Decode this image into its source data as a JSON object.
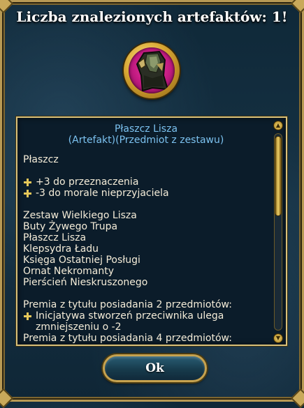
{
  "dialog": {
    "title": "Liczba znalezionych artefaktów: 1!",
    "ok_label": "Ok"
  },
  "item": {
    "icon": "cloak-artifact-icon",
    "name": "Płaszcz Lisza",
    "type": "(Artefakt)(Przedmiot z zestawu)",
    "slot": "Płaszcz",
    "bonuses": [
      "+3 do przeznaczenia",
      "-3 do morale nieprzyjaciela"
    ],
    "set_name": "Zestaw Wielkiego Lisza",
    "set_items": [
      "Buty Żywego Trupa",
      "Płaszcz Lisza",
      "Klepsydra Ładu",
      "Księga Ostatniej Posługi",
      "Ornat Nekromanty",
      "Pierścień Nieskruszonego"
    ],
    "set_bonus_2_header": "Premia z tytułu posiadania 2 przedmiotów:",
    "set_bonus_2_text": "Inicjatywa stworzeń przeciwnika ulega zmniejszeniu o -2",
    "set_bonus_4_header": "Premia z tytułu posiadania 4 przedmiotów:"
  },
  "colors": {
    "accent_gold": "#c6a24f",
    "item_name": "#7cc2f0",
    "text": "#f4ecd8",
    "icon_bg": "#c01a80"
  }
}
